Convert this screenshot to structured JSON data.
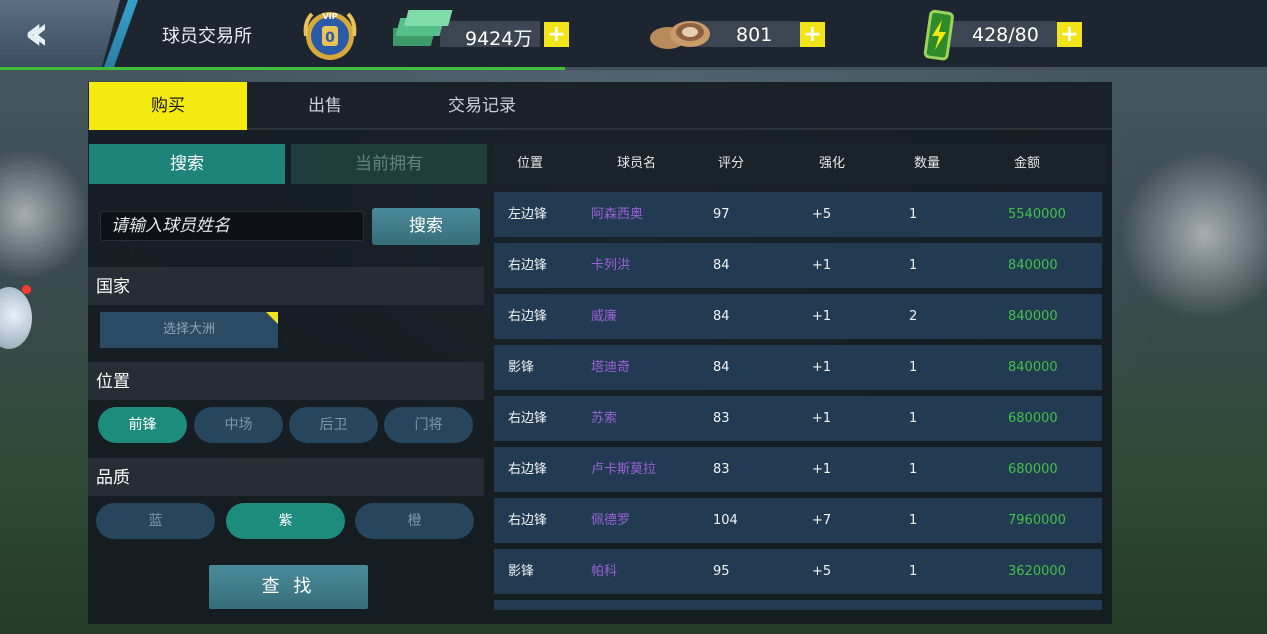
{
  "window": {
    "title": "球员交易所",
    "progress_pct": 44.6
  },
  "header": {
    "money": "9424万",
    "coins": "801",
    "energy": "428/80",
    "vip_badge_text": "VIP",
    "vip_level": "0"
  },
  "tabs": [
    {
      "label": "购买",
      "active": true
    },
    {
      "label": "出售",
      "active": false
    },
    {
      "label": "交易记录",
      "active": false
    }
  ],
  "left": {
    "subtabs": [
      {
        "label": "搜索",
        "active": true
      },
      {
        "label": "当前拥有",
        "active": false
      }
    ],
    "search": {
      "placeholder": "请输入球员姓名",
      "button": "搜索"
    },
    "country_label": "国家",
    "continent_button": "选择大洲",
    "position_label": "位置",
    "positions": [
      {
        "label": "前锋",
        "selected": true
      },
      {
        "label": "中场",
        "selected": false
      },
      {
        "label": "后卫",
        "selected": false
      },
      {
        "label": "门将",
        "selected": false
      }
    ],
    "quality_label": "品质",
    "qualities": [
      {
        "label": "蓝",
        "selected": false
      },
      {
        "label": "紫",
        "selected": true
      },
      {
        "label": "橙",
        "selected": false
      }
    ],
    "find_button": "查 找"
  },
  "table": {
    "columns": [
      "位置",
      "球员名",
      "评分",
      "强化",
      "数量",
      "金额"
    ],
    "rows": [
      [
        "左边锋",
        "阿森西奥",
        "97",
        "+5",
        "1",
        "5540000"
      ],
      [
        "右边锋",
        "卡列洪",
        "84",
        "+1",
        "1",
        "840000"
      ],
      [
        "右边锋",
        "威廉",
        "84",
        "+1",
        "2",
        "840000"
      ],
      [
        "影锋",
        "塔迪奇",
        "84",
        "+1",
        "1",
        "840000"
      ],
      [
        "右边锋",
        "苏索",
        "83",
        "+1",
        "1",
        "680000"
      ],
      [
        "右边锋",
        "卢卡斯莫拉",
        "83",
        "+1",
        "1",
        "680000"
      ],
      [
        "右边锋",
        "佩德罗",
        "104",
        "+7",
        "1",
        "7960000"
      ],
      [
        "影锋",
        "帕科",
        "95",
        "+5",
        "1",
        "3620000"
      ]
    ]
  },
  "colors": {
    "accent_yellow": "#f3ea10",
    "teal": "#1e8378",
    "name_purple": "#9a62d6",
    "price_green": "#43c04a"
  }
}
